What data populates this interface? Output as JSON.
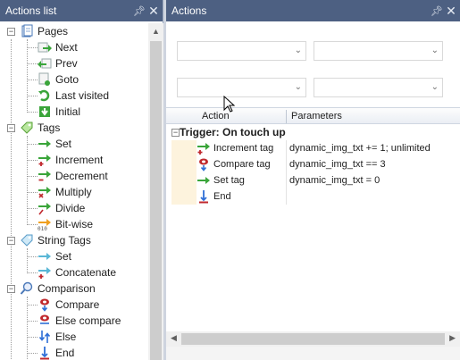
{
  "left_panel": {
    "title": "Actions list",
    "pin": "▕⨅",
    "close": "✕"
  },
  "right_panel": {
    "title": "Actions",
    "pin": "▕⨅",
    "close": "✕"
  },
  "tree": {
    "pages": {
      "label": "Pages",
      "items": [
        "Next",
        "Prev",
        "Goto",
        "Last visited",
        "Initial"
      ]
    },
    "tags": {
      "label": "Tags",
      "items": [
        "Set",
        "Increment",
        "Decrement",
        "Multiply",
        "Divide",
        "Bit-wise"
      ]
    },
    "string_tags": {
      "label": "String Tags",
      "items": [
        "Set",
        "Concatenate"
      ]
    },
    "comparison": {
      "label": "Comparison",
      "items": [
        "Compare",
        "Else compare",
        "Else",
        "End"
      ]
    }
  },
  "grid": {
    "columns": [
      "Action",
      "Parameters"
    ],
    "trigger": "Trigger: On touch up",
    "rows": [
      {
        "action": "Increment tag",
        "params": "dynamic_img_txt += 1; unlimited"
      },
      {
        "action": "Compare tag",
        "params": "dynamic_img_txt == 3"
      },
      {
        "action": "Set tag",
        "params": "dynamic_img_txt = 0"
      },
      {
        "action": "End",
        "params": ""
      }
    ]
  },
  "colors": {
    "title_bar": "#4d6082",
    "background": "#ced4df",
    "green_arrow": "#3aa53a",
    "red": "#c0282d",
    "blue": "#2f6fd6"
  }
}
